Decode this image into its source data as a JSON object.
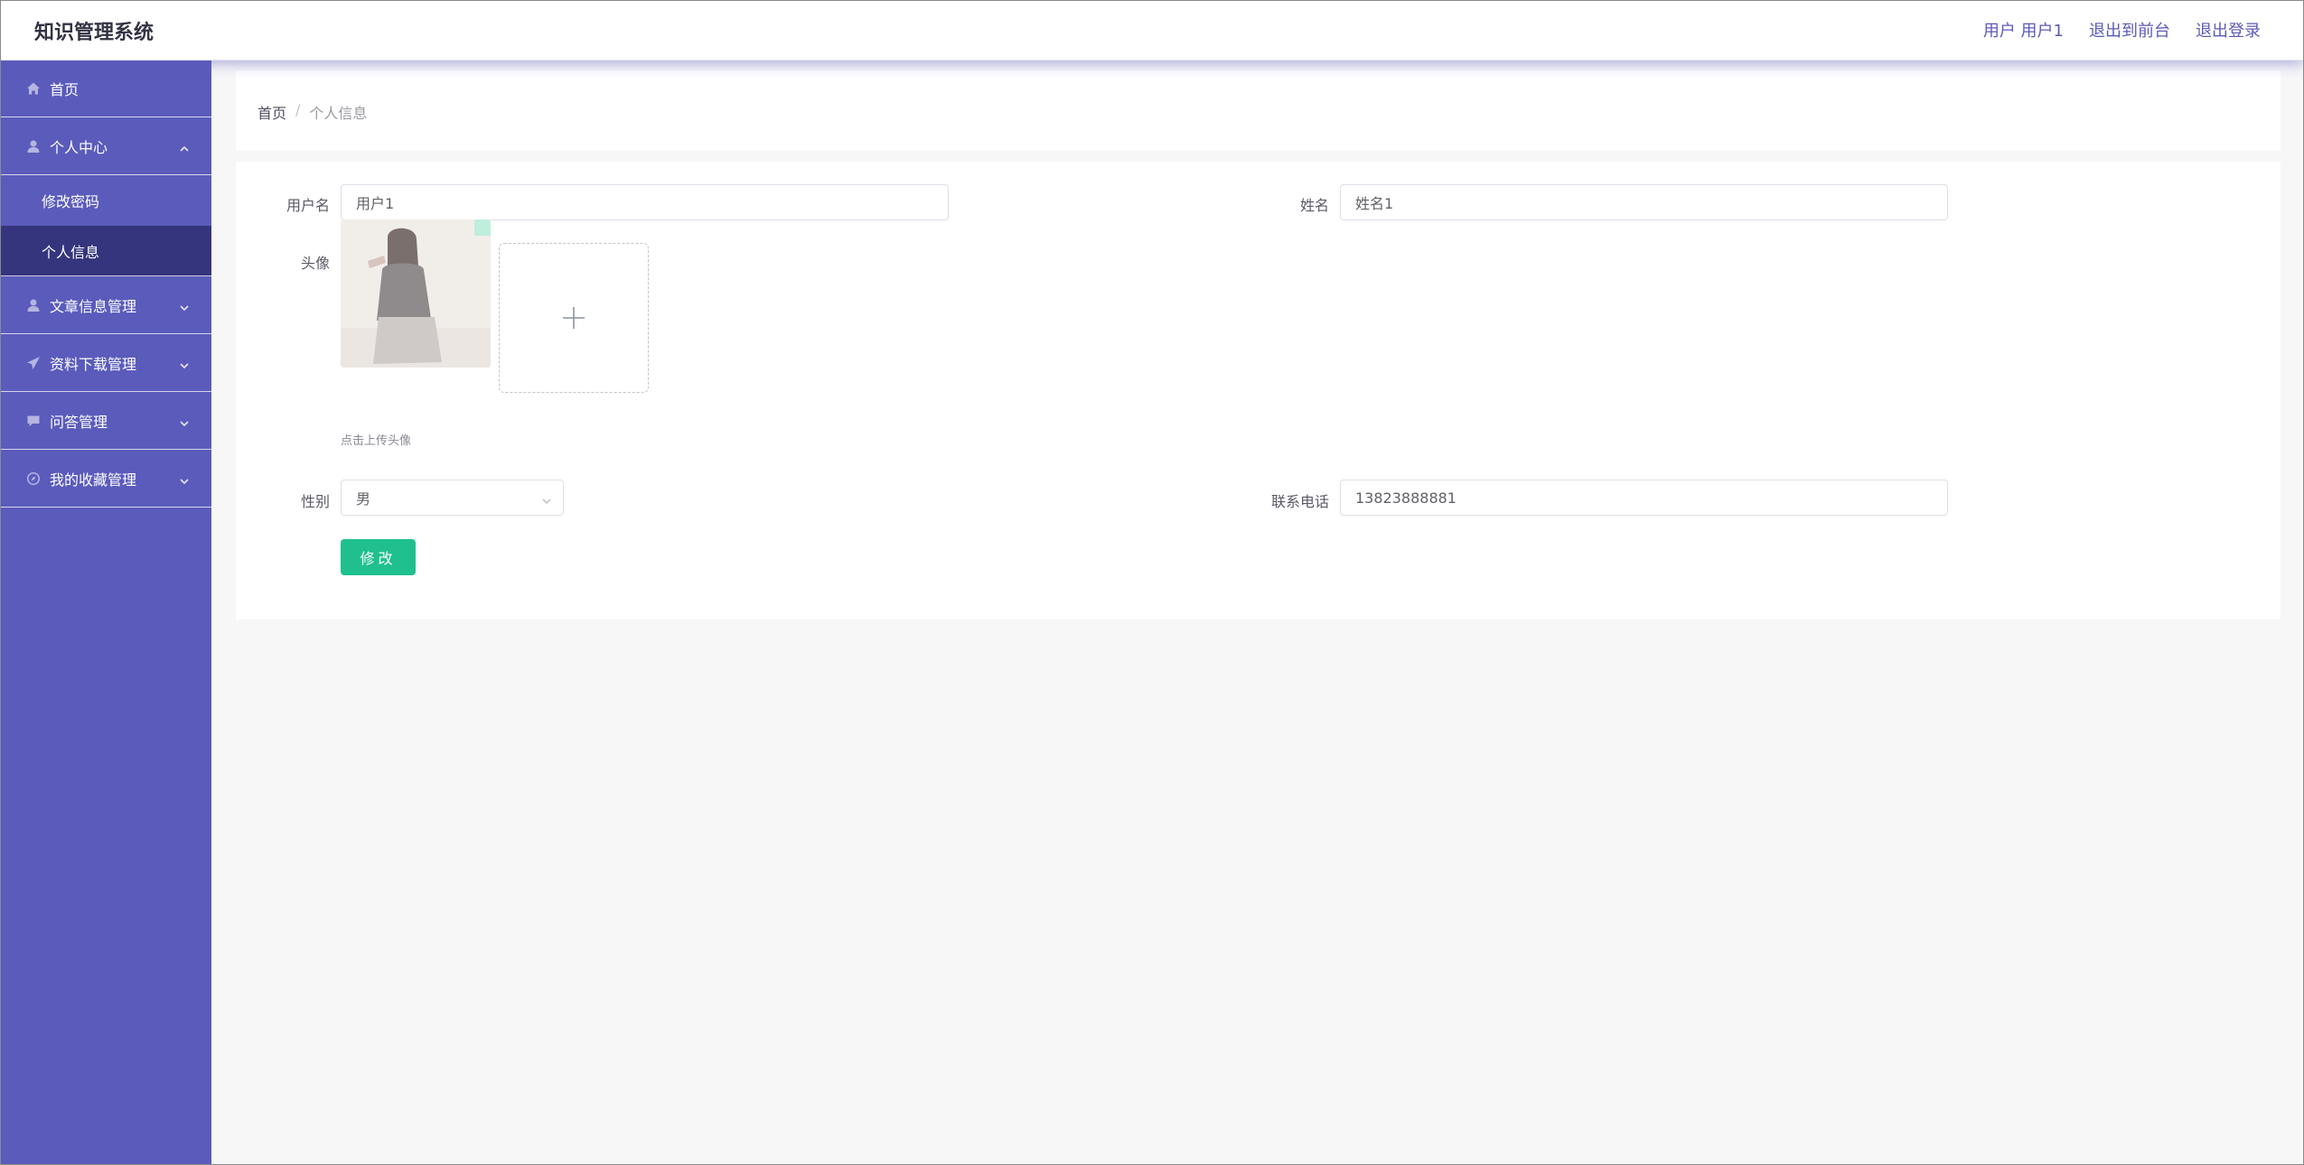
{
  "app": {
    "title": "知识管理系统"
  },
  "header": {
    "user_label": "用户 用户1",
    "back_to_front": "退出到前台",
    "logout": "退出登录"
  },
  "sidebar": {
    "items": [
      {
        "label": "首页",
        "icon": "home-icon"
      },
      {
        "label": "个人中心",
        "icon": "user-icon",
        "expanded": true,
        "children": [
          {
            "label": "修改密码"
          },
          {
            "label": "个人信息",
            "active": true
          }
        ]
      },
      {
        "label": "文章信息管理",
        "icon": "user-icon"
      },
      {
        "label": "资料下载管理",
        "icon": "send-icon"
      },
      {
        "label": "问答管理",
        "icon": "chat-icon"
      },
      {
        "label": "我的收藏管理",
        "icon": "compass-icon"
      }
    ]
  },
  "breadcrumb": {
    "home": "首页",
    "separator": "/",
    "current": "个人信息"
  },
  "form": {
    "username_label": "用户名",
    "username_value": "用户1",
    "name_label": "姓名",
    "name_value": "姓名1",
    "avatar_label": "头像",
    "upload_tip": "点击上传头像",
    "gender_label": "性别",
    "gender_value": "男",
    "phone_label": "联系电话",
    "phone_value": "13823888881",
    "submit_label": "修改"
  },
  "colors": {
    "sidebar_bg": "#5b5bbc",
    "sidebar_active": "#35357e",
    "accent_button": "#1fc08e",
    "header_link": "#5a5ab8"
  }
}
